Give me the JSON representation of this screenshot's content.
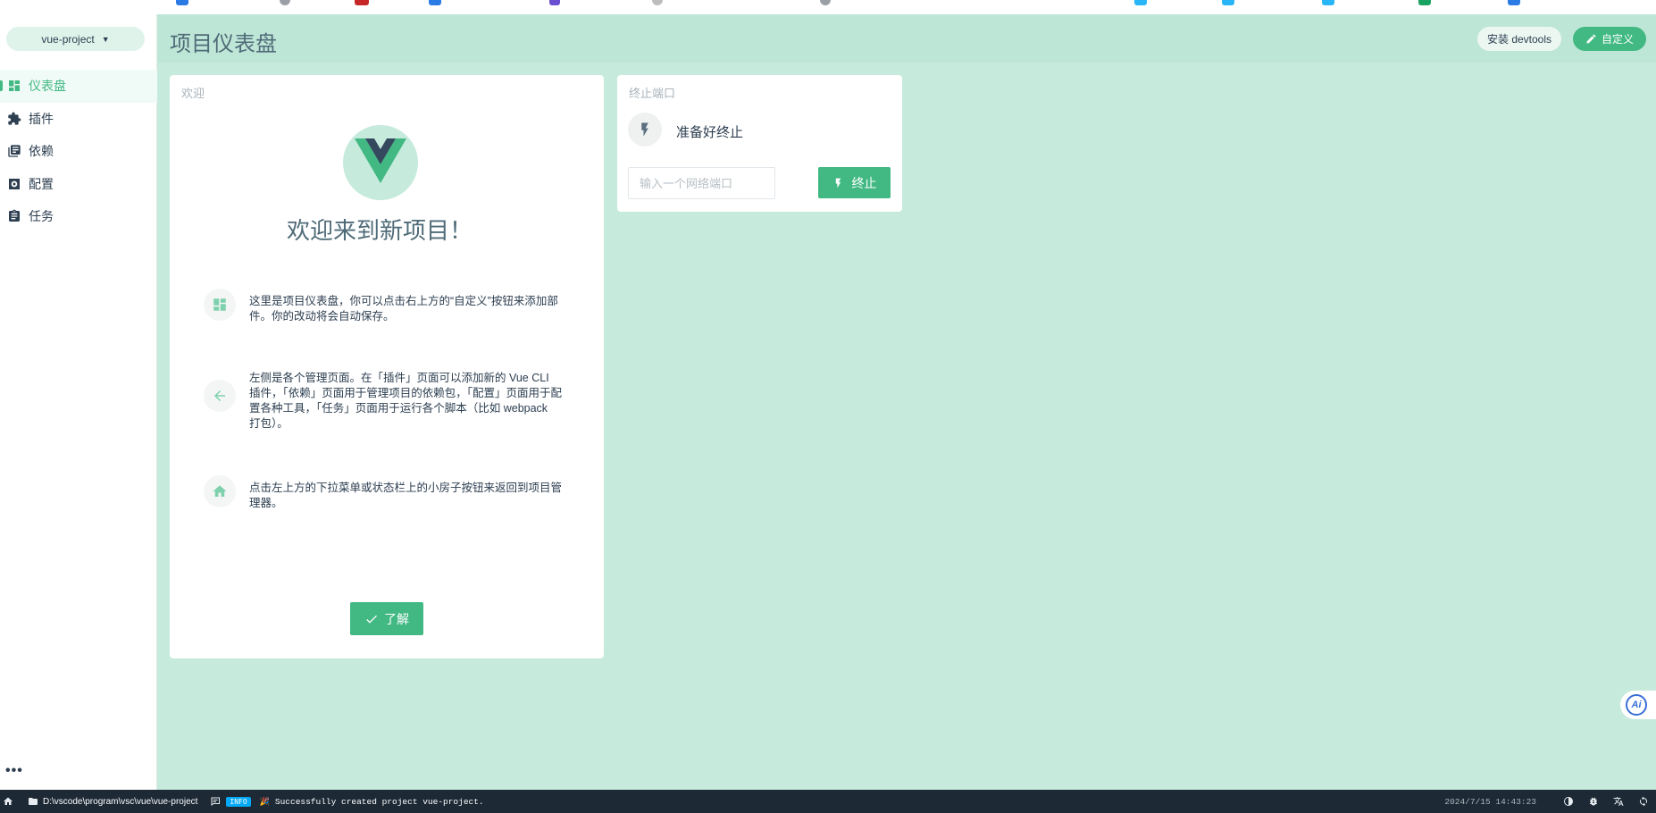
{
  "sidebar": {
    "project_selector": "vue-project",
    "items": [
      {
        "label": "仪表盘",
        "icon": "dashboard-icon",
        "active": true
      },
      {
        "label": "插件",
        "icon": "puzzle-icon",
        "active": false
      },
      {
        "label": "依赖",
        "icon": "library-books-icon",
        "active": false
      },
      {
        "label": "配置",
        "icon": "settings-icon",
        "active": false
      },
      {
        "label": "任务",
        "icon": "clipboard-icon",
        "active": false
      }
    ],
    "more_label": "•••"
  },
  "header": {
    "title": "项目仪表盘",
    "devtools_label": "安装 devtools",
    "customize_label": "自定义"
  },
  "welcome": {
    "card_title": "欢迎",
    "heading": "欢迎来到新项目！",
    "tips": [
      {
        "icon": "dashboard-icon",
        "text": "这里是项目仪表盘，你可以点击右上方的“自定义”按钮来添加部件。你的改动将会自动保存。"
      },
      {
        "icon": "arrow-left-icon",
        "text": "左侧是各个管理页面。在「插件」页面可以添加新的 Vue CLI 插件，「依赖」页面用于管理项目的依赖包，「配置」页面用于配置各种工具，「任务」页面用于运行各个脚本（比如 webpack 打包）。"
      },
      {
        "icon": "home-icon",
        "text": "点击左上方的下拉菜单或状态栏上的小房子按钮来返回到项目管理器。"
      }
    ],
    "ok_label": "了解"
  },
  "kill_port": {
    "card_title": "终止端口",
    "status": "准备好终止",
    "input_placeholder": "输入一个网络端口",
    "button_label": "终止"
  },
  "statusbar": {
    "path": "D:\\vscode\\program\\vsc\\vue\\vue-project",
    "log_level": "INFO",
    "log_message": "Successfully created project vue-project.",
    "timestamp": "2024/7/15 14:43:23"
  },
  "ai_badge": "Ai",
  "colors": {
    "accent": "#42b983",
    "background": "#c6eadc",
    "statusbar": "#1d2935",
    "info": "#03a9f4"
  }
}
